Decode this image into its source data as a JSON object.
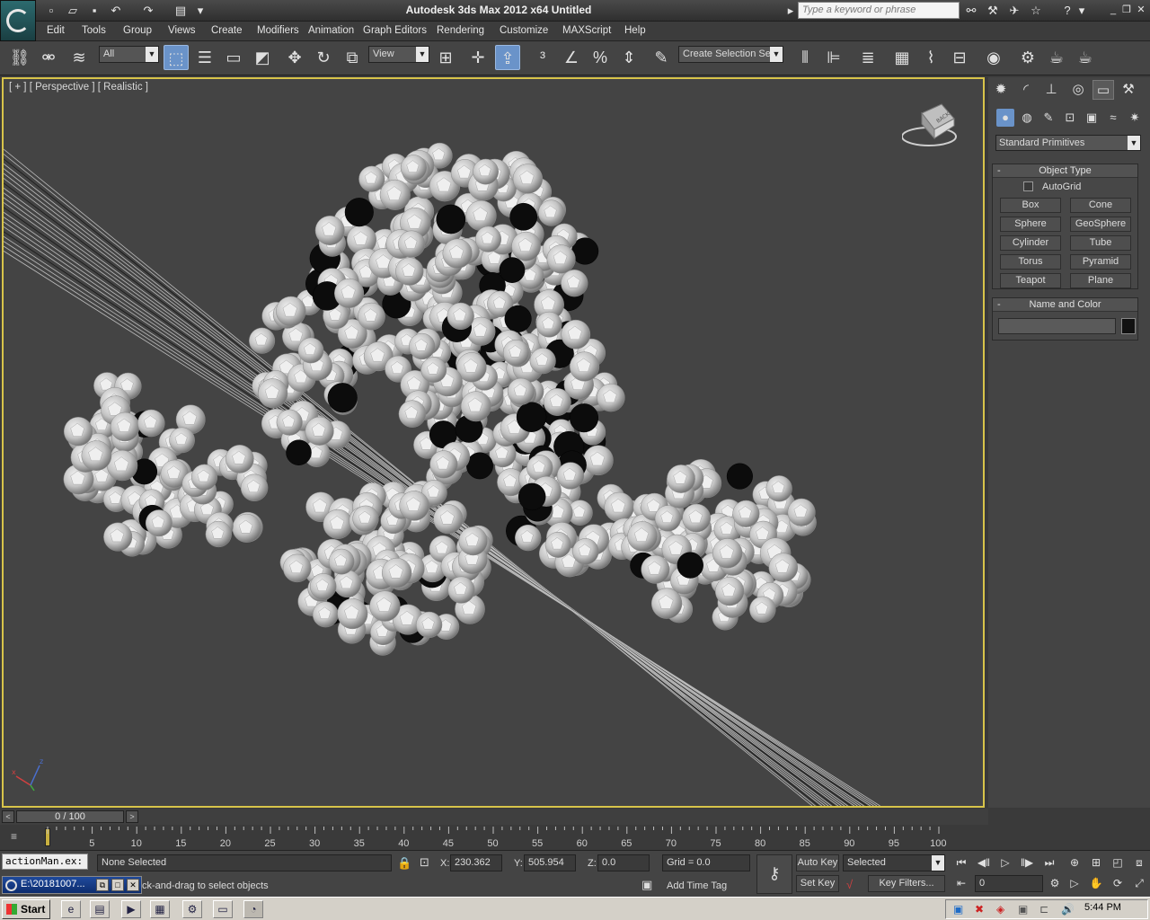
{
  "titlebar": {
    "title": "Autodesk 3ds Max  2012 x64      Untitled",
    "search_placeholder": "Type a keyword or phrase"
  },
  "menubar": {
    "items": [
      "Edit",
      "Tools",
      "Group",
      "Views",
      "Create",
      "Modifiers",
      "Animation",
      "Graph Editors",
      "Rendering",
      "Customize",
      "MAXScript",
      "Help"
    ]
  },
  "toolbar": {
    "selection_filter": "All",
    "reference_coord": "View",
    "named_selection": "Create Selection Se"
  },
  "viewport": {
    "label": "[ + ] [ Perspective ] [ Realistic ]",
    "viewcube_face": "BACK"
  },
  "command_panel": {
    "category": "Standard Primitives",
    "object_type_title": "Object Type",
    "autogrid_label": "AutoGrid",
    "primitives": [
      "Box",
      "Cone",
      "Sphere",
      "GeoSphere",
      "Cylinder",
      "Tube",
      "Torus",
      "Pyramid",
      "Teapot",
      "Plane"
    ],
    "name_color_title": "Name and Color"
  },
  "time_slider": {
    "position": "0 / 100",
    "ticks": [
      "5",
      "10",
      "15",
      "20",
      "25",
      "30",
      "35",
      "40",
      "45",
      "50",
      "55",
      "60",
      "65",
      "70",
      "75",
      "80",
      "85",
      "90",
      "95",
      "100"
    ]
  },
  "status": {
    "listener_text": "actionMan.ex:",
    "selection": "None Selected",
    "prompt": "ck-and-drag to select objects",
    "x_label": "X:",
    "x_value": "230.362",
    "y_label": "Y:",
    "y_value": "505.954",
    "z_label": "Z:",
    "z_value": "0.0",
    "grid": "Grid = 0.0",
    "add_time_tag": "Add Time Tag",
    "auto_key": "Auto Key",
    "set_key": "Set Key",
    "key_mode": "Selected",
    "key_filters": "Key Filters...",
    "frame": "0",
    "mini_window_title": "E:\\20181007..."
  },
  "taskbar": {
    "start": "Start",
    "clock": "5:44 PM"
  }
}
